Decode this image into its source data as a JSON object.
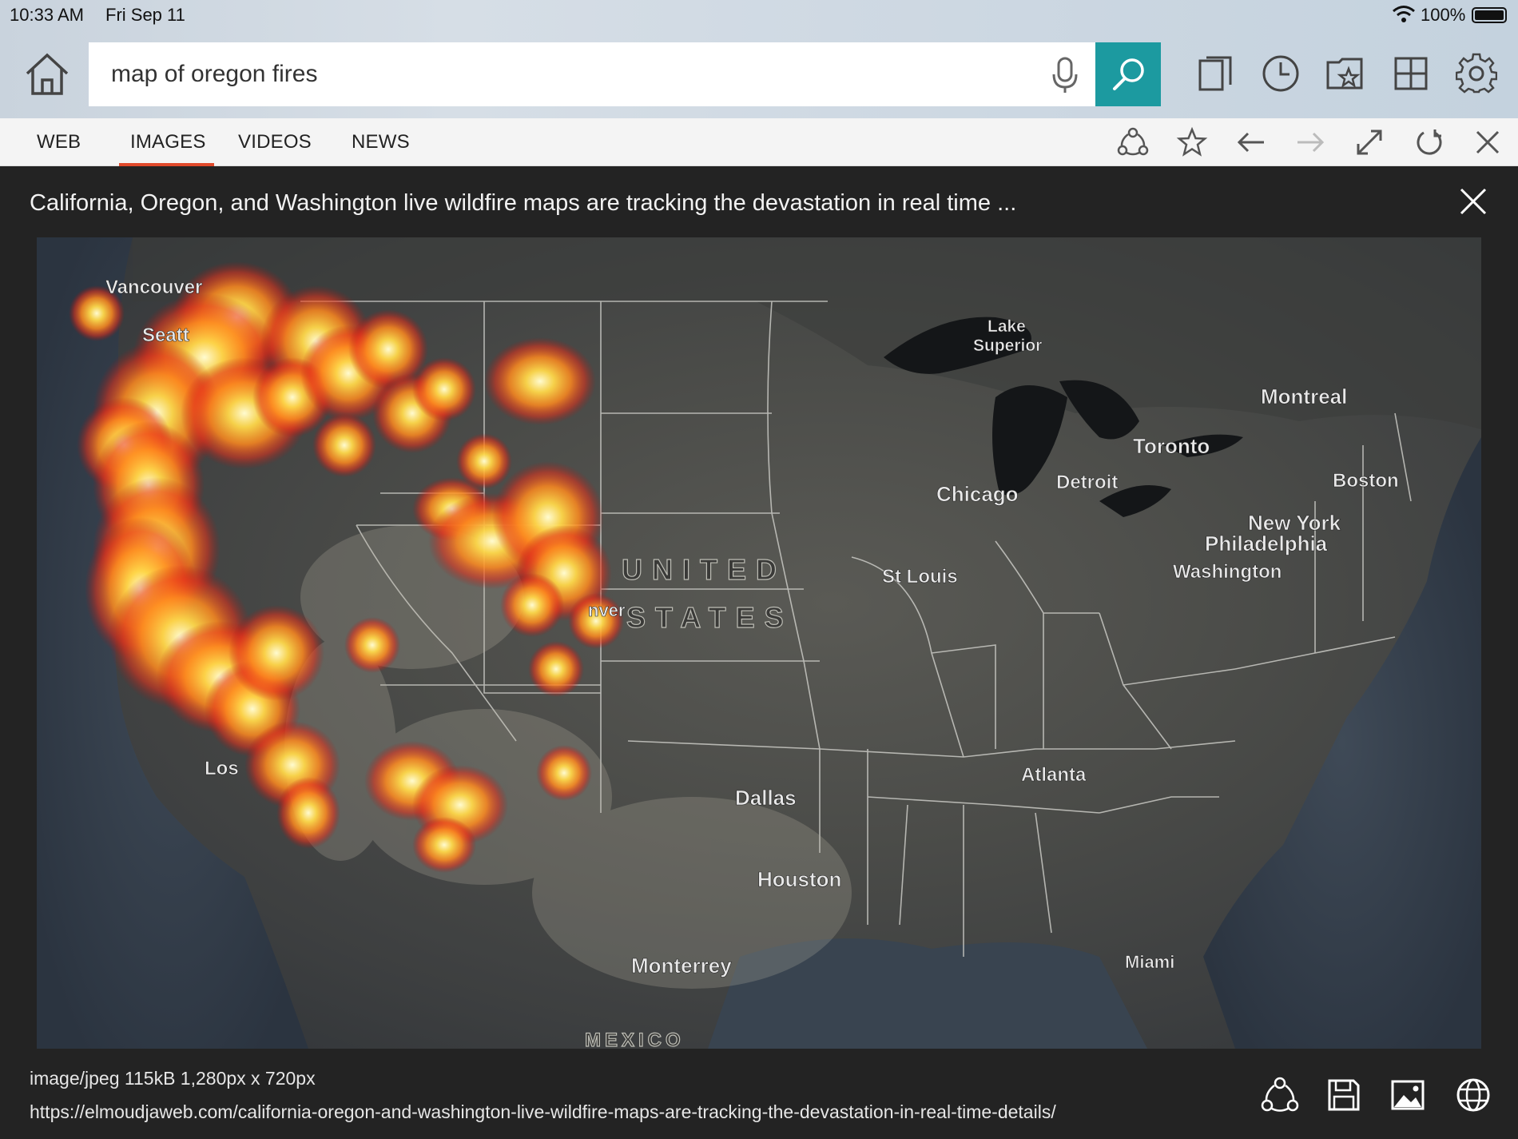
{
  "status_bar": {
    "time": "10:33 AM",
    "date": "Fri Sep 11",
    "battery": "100%"
  },
  "search": {
    "value": "map of oregon fires",
    "placeholder": ""
  },
  "tabs": [
    {
      "label": "WEB"
    },
    {
      "label": "IMAGES"
    },
    {
      "label": "VIDEOS"
    },
    {
      "label": "NEWS"
    }
  ],
  "viewer": {
    "title": "California, Oregon, and Washington live wildfire maps are tracking the devastation in real time ...",
    "meta": "image/jpeg 115kB 1,280px x 720px",
    "url": "https://elmoudjaweb.com/california-oregon-and-washington-live-wildfire-maps-are-tracking-the-devastation-in-real-time-details/"
  },
  "map_labels": {
    "vancouver": "Vancouver",
    "seattle": "Seatt",
    "lake_superior_1": "Lake",
    "lake_superior_2": "Superior",
    "montreal": "Montreal",
    "toronto": "Toronto",
    "boston": "Boston",
    "detroit": "Detroit",
    "chicago": "Chicago",
    "new_york": "New York",
    "philadelphia": "Philadelphia",
    "washington": "Washington",
    "united": "UNITED",
    "states": "STATES",
    "denver": "nver",
    "st_louis": "St Louis",
    "atlanta": "Atlanta",
    "los_angeles": "Los",
    "dallas": "Dallas",
    "houston": "Houston",
    "monterrey": "Monterrey",
    "miami": "Miami",
    "mexico": "MEXICO"
  },
  "colors": {
    "accent_teal": "#1c9aa0",
    "tab_underline": "#e0492b",
    "viewer_bg": "#232323",
    "fire_core": "#fff3a0",
    "fire_edge": "#e8321a"
  },
  "icons": [
    "home-icon",
    "microphone-icon",
    "search-icon",
    "tabs-icon",
    "history-icon",
    "favorites-icon",
    "apps-grid-icon",
    "settings-icon",
    "share-icon",
    "star-icon",
    "back-arrow-icon",
    "forward-arrow-icon",
    "expand-icon",
    "refresh-icon",
    "close-icon",
    "save-icon",
    "image-icon",
    "globe-icon"
  ]
}
